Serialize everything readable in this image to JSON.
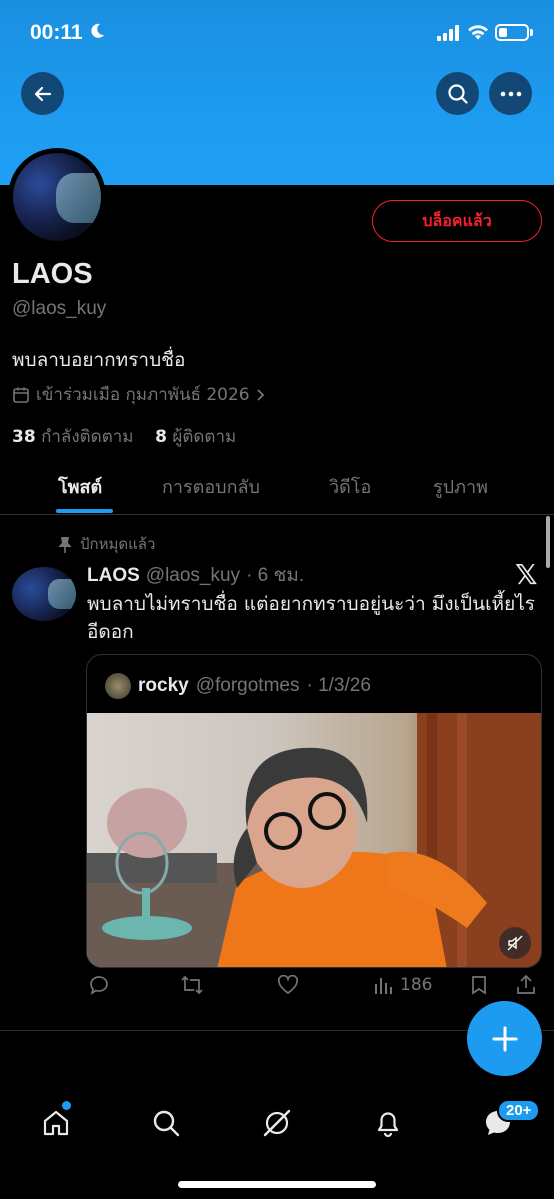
{
  "status_bar": {
    "time": "00:11"
  },
  "profile": {
    "display_name": "LAOS",
    "handle": "@laos_kuy",
    "bio": "พบลาบอยากทราบชื่อ",
    "joined": "เข้าร่วมเมือ กุมภาพันธ์ 2026",
    "following_count": "38",
    "following_label": "กำลังติดตาม",
    "followers_count": "8",
    "followers_label": "ผู้ติดตาม",
    "blocked_label": "บล็อคแล้ว"
  },
  "tabs": [
    {
      "label": "โพสต์",
      "active": true
    },
    {
      "label": "การตอบกลับ",
      "active": false
    },
    {
      "label": "วิดีโอ",
      "active": false
    },
    {
      "label": "รูปภาพ",
      "active": false
    }
  ],
  "post": {
    "pinned_label": "ปักหมุดแล้ว",
    "author_name": "LAOS",
    "author_handle": "@laos_kuy",
    "time": "· 6 ชม.",
    "text": "พบลาบไม่ทราบชื่อ แต่อยากทราบอยู่นะว่า มึงเป็นเหี้ยไร อีดอก",
    "quote": {
      "author_name": "rocky",
      "author_handle": "@forgotmes",
      "date": "· 1/3/26"
    },
    "views": "186"
  },
  "badges": {
    "messages": "20+"
  },
  "colors": {
    "accent": "#1d9bf0",
    "danger": "#f4212e",
    "muted": "#71767b",
    "background": "#000000"
  }
}
